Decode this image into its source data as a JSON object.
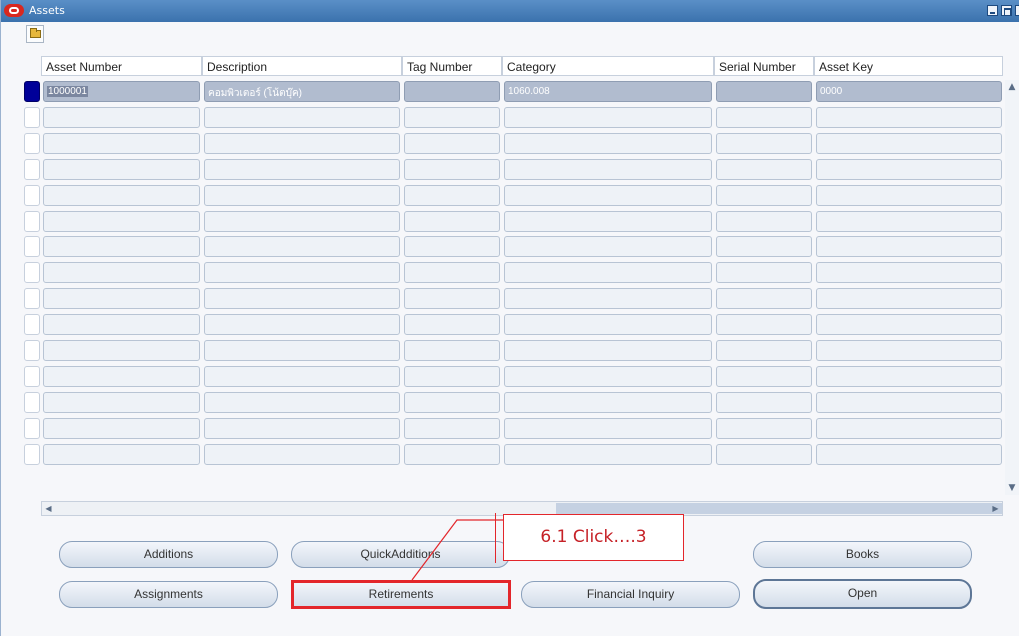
{
  "window": {
    "title": "Assets"
  },
  "table": {
    "columns": [
      "Asset Number",
      "Description",
      "Tag Number",
      "Category",
      "Serial Number",
      "Asset Key"
    ],
    "rows": [
      [
        "1000001",
        "คอมพิวเตอร์ (โน้ตบุ๊ค)",
        "",
        "1060.008",
        "",
        "0000"
      ]
    ],
    "visible_row_count": 15
  },
  "buttons": {
    "additions": "Additions",
    "quick_additions": "QuickAdditions",
    "books": "Books",
    "assignments": "Assignments",
    "retirements": "Retirements",
    "financial_inquiry": "Financial Inquiry",
    "open": "Open"
  },
  "callout": {
    "text": "6.1 Click….3"
  },
  "colors": {
    "title_bar": "#3b72ad",
    "highlight": "#e3262b",
    "row_indicator": "#000099"
  },
  "icons": {
    "app": "oracle-logo-icon",
    "toolbar": "folder-icon",
    "minimize": "minimize-icon",
    "maximize": "maximize-icon"
  }
}
